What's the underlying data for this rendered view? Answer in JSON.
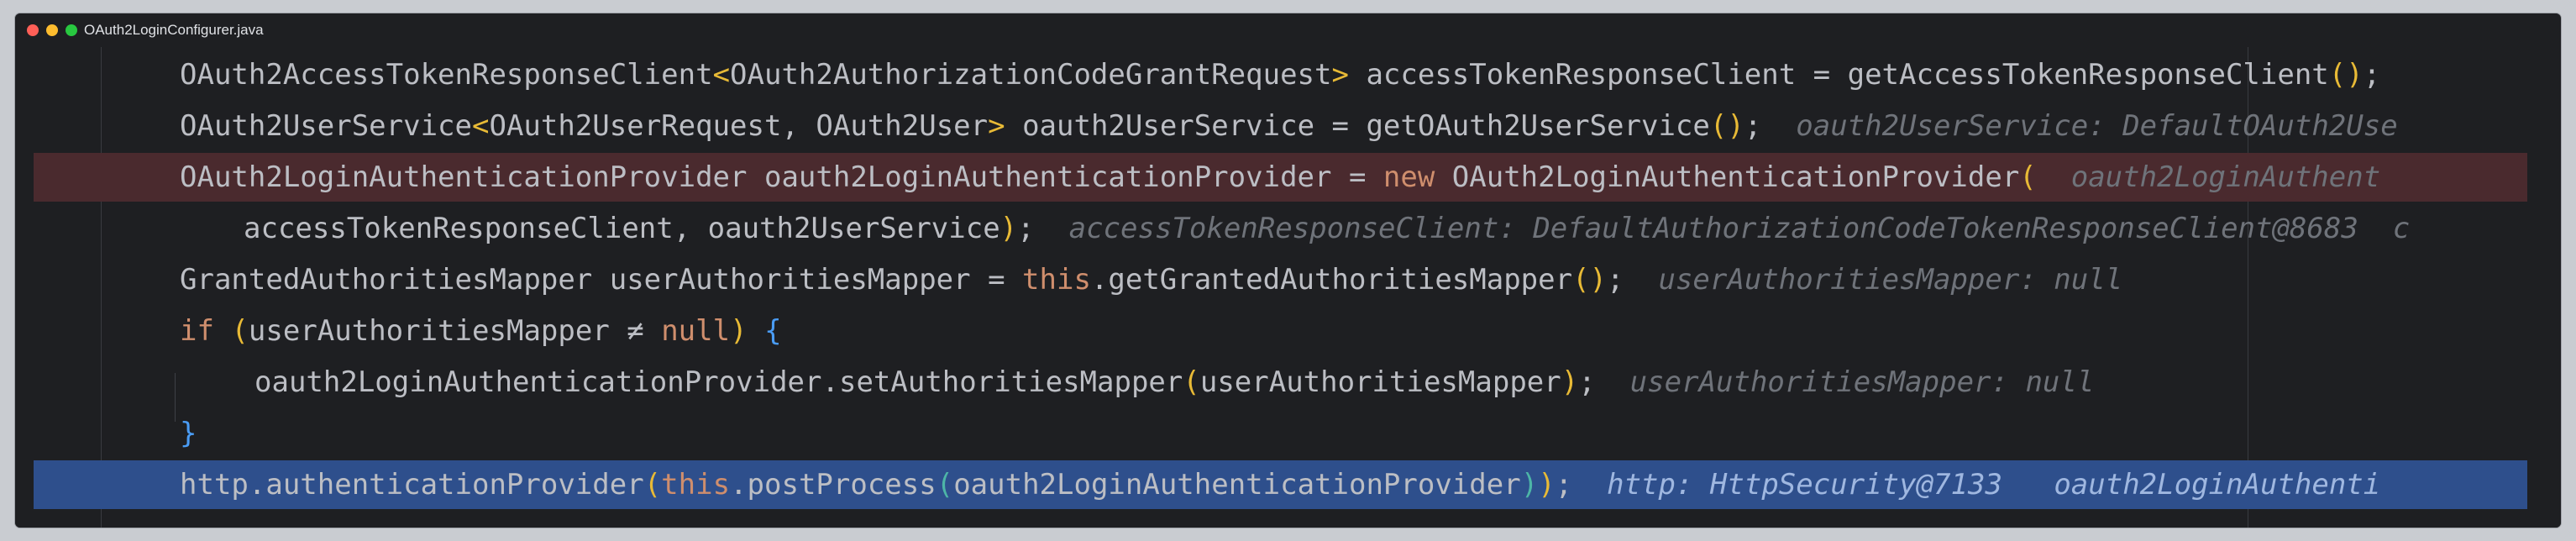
{
  "window": {
    "title": "OAuth2LoginConfigurer.java",
    "colors": {
      "background": "#1e1f22",
      "error_line": "#4a2a2e",
      "current_line": "#2e4f8c",
      "keyword": "#cf8e6d",
      "hint": "#6f737a"
    }
  },
  "editor": {
    "lines": [
      {
        "id": 1,
        "parts": [
          {
            "t": "OAuth2AccessTokenResponseClient",
            "c": ""
          },
          {
            "t": "<",
            "c": "br"
          },
          {
            "t": "OAuth2AuthorizationCodeGrantRequest",
            "c": ""
          },
          {
            "t": ">",
            "c": "br"
          },
          {
            "t": " accessTokenResponseClient = getAccessTokenResponseClient",
            "c": ""
          },
          {
            "t": "()",
            "c": "br"
          },
          {
            "t": ";",
            "c": ""
          }
        ],
        "hint": ""
      },
      {
        "id": 2,
        "parts": [
          {
            "t": "OAuth2UserService",
            "c": ""
          },
          {
            "t": "<",
            "c": "br"
          },
          {
            "t": "OAuth2UserRequest, OAuth2User",
            "c": ""
          },
          {
            "t": ">",
            "c": "br"
          },
          {
            "t": " oauth2UserService = getOAuth2UserService",
            "c": ""
          },
          {
            "t": "()",
            "c": "br"
          },
          {
            "t": ";",
            "c": ""
          }
        ],
        "hint": "oauth2UserService: DefaultOAuth2Use"
      },
      {
        "id": 3,
        "parts": [
          {
            "t": "OAuth2LoginAuthenticationProvider oauth2LoginAuthenticationProvider = ",
            "c": ""
          },
          {
            "t": "new",
            "c": "kw"
          },
          {
            "t": " OAuth2LoginAuthenticationProvider",
            "c": ""
          },
          {
            "t": "(",
            "c": "br"
          }
        ],
        "hint": "oauth2LoginAuthent"
      },
      {
        "id": 4,
        "parts": [
          {
            "t": "accessTokenResponseClient, oauth2UserService",
            "c": ""
          },
          {
            "t": ")",
            "c": "br"
          },
          {
            "t": ";",
            "c": ""
          }
        ],
        "hint": "accessTokenResponseClient: DefaultAuthorizationCodeTokenResponseClient@8683  c"
      },
      {
        "id": 5,
        "parts": [
          {
            "t": "GrantedAuthoritiesMapper userAuthoritiesMapper = ",
            "c": ""
          },
          {
            "t": "this",
            "c": "kw"
          },
          {
            "t": ".getGrantedAuthoritiesMapper",
            "c": ""
          },
          {
            "t": "()",
            "c": "br"
          },
          {
            "t": ";",
            "c": ""
          }
        ],
        "hint": "userAuthoritiesMapper: null"
      },
      {
        "id": 6,
        "parts": [
          {
            "t": "if",
            "c": "kw"
          },
          {
            "t": " ",
            "c": ""
          },
          {
            "t": "(",
            "c": "br"
          },
          {
            "t": "userAuthoritiesMapper ≠ ",
            "c": ""
          },
          {
            "t": "null",
            "c": "kw"
          },
          {
            "t": ")",
            "c": "br"
          },
          {
            "t": " ",
            "c": ""
          },
          {
            "t": "{",
            "c": "br3"
          }
        ],
        "hint": ""
      },
      {
        "id": 7,
        "parts": [
          {
            "t": "oauth2LoginAuthenticationProvider.setAuthoritiesMapper",
            "c": ""
          },
          {
            "t": "(",
            "c": "br"
          },
          {
            "t": "userAuthoritiesMapper",
            "c": ""
          },
          {
            "t": ")",
            "c": "br"
          },
          {
            "t": ";",
            "c": ""
          }
        ],
        "hint": "userAuthoritiesMapper: null"
      },
      {
        "id": 8,
        "parts": [
          {
            "t": "}",
            "c": "br3"
          }
        ],
        "hint": ""
      },
      {
        "id": 9,
        "parts": [
          {
            "t": "http.authenticationProvider",
            "c": ""
          },
          {
            "t": "(",
            "c": "br"
          },
          {
            "t": "this",
            "c": "kw"
          },
          {
            "t": ".postProcess",
            "c": ""
          },
          {
            "t": "(",
            "c": "br2"
          },
          {
            "t": "oauth2LoginAuthenticationProvider",
            "c": ""
          },
          {
            "t": ")",
            "c": "br2"
          },
          {
            "t": ")",
            "c": "br"
          },
          {
            "t": ";",
            "c": ""
          }
        ],
        "hint": "http: HttpSecurity@7133   oauth2LoginAuthenti"
      }
    ]
  }
}
